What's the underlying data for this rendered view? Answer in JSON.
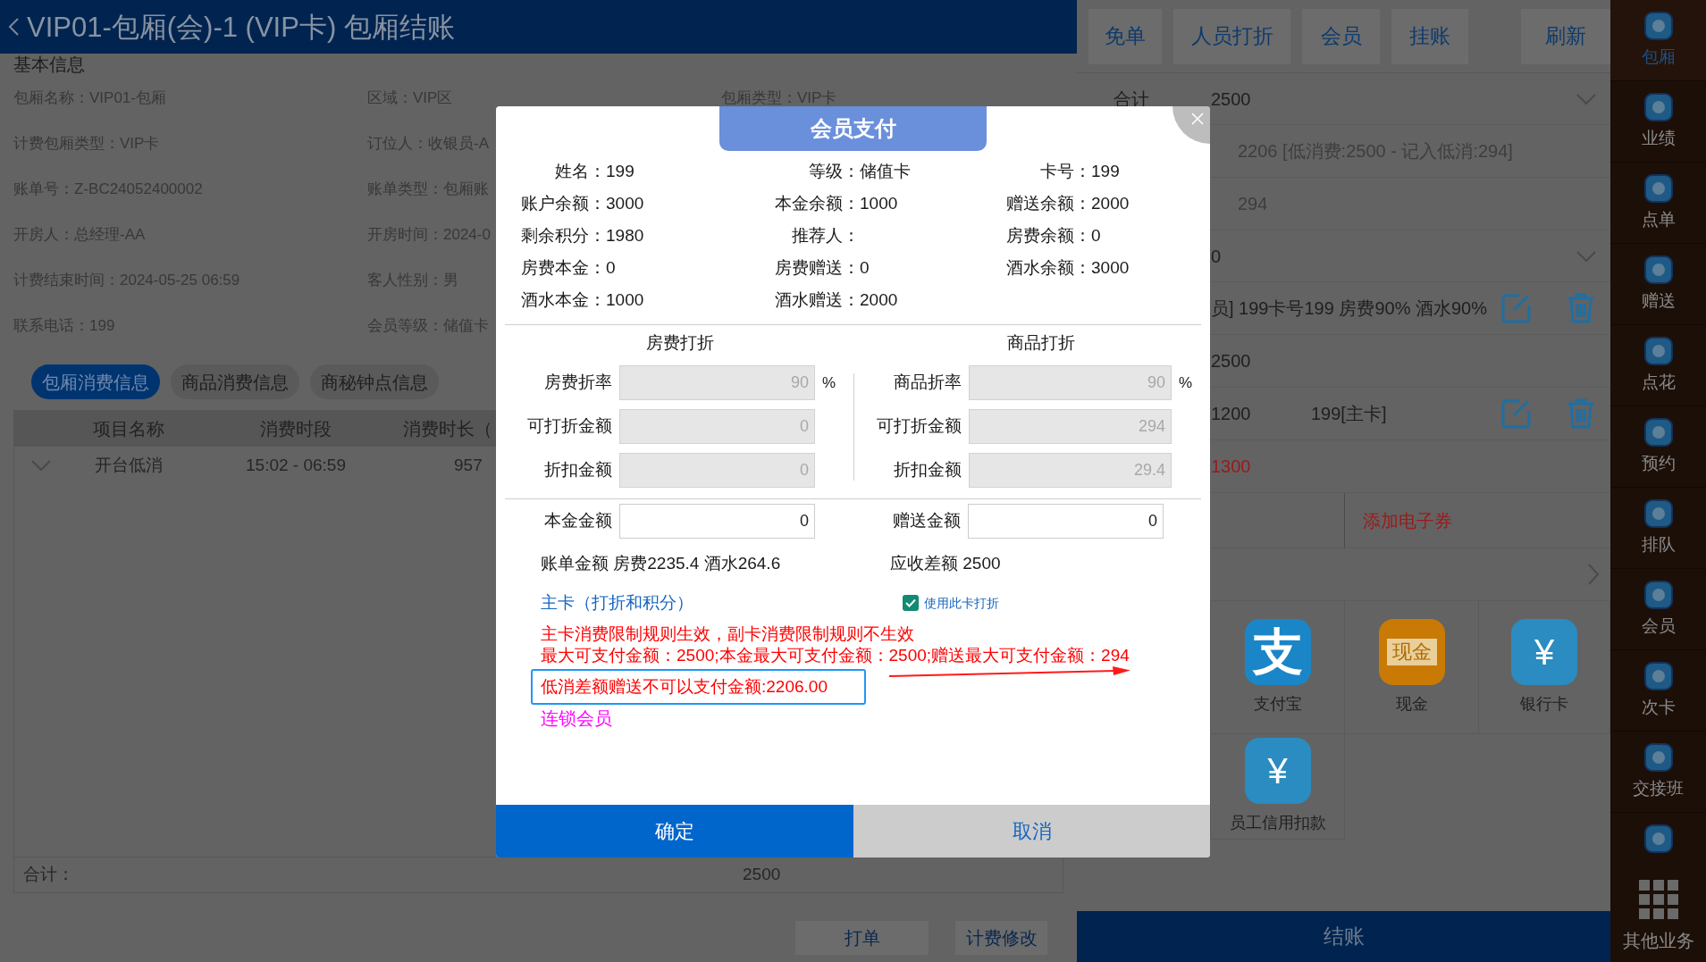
{
  "header": {
    "title": "VIP01-包厢(会)-1 (VIP卡) 包厢结账"
  },
  "basic_info": {
    "title": "基本信息",
    "rows": [
      [
        "包厢名称：VIP01-包厢",
        "区域：VIP区",
        "包厢类型：VIP卡"
      ],
      [
        "计费包厢类型：VIP卡",
        "订位人：收银员-A"
      ],
      [
        "账单号：Z-BC24052400002",
        "账单类型：包厢账"
      ],
      [
        "开房人：总经理-AA",
        "开房时间：2024-0"
      ],
      [
        "计费结束时间：2024-05-25 06:59",
        "客人性别：男"
      ],
      [
        "联系电话：199",
        "会员等级：储值卡"
      ]
    ]
  },
  "tabs": [
    {
      "label": "包厢消费信息",
      "selected": true
    },
    {
      "label": "商品消费信息",
      "selected": false
    },
    {
      "label": "商秘钟点信息",
      "selected": false
    }
  ],
  "table": {
    "columns": [
      "项目名称",
      "消费时段",
      "消费时长（"
    ],
    "rows": [
      {
        "expanded": false,
        "cells": [
          "开台低消",
          "15:02 - 06:59",
          "957"
        ]
      }
    ],
    "total_label": "合计：",
    "total_value": "2500"
  },
  "bottom_buttons": [
    "打单",
    "计费修改"
  ],
  "right_panel": {
    "actions": [
      "免单",
      "人员打折",
      "会员",
      "挂账",
      "刷新"
    ],
    "rows": [
      {
        "kind": "total",
        "label": "合计",
        "value": "2500",
        "expanded": false
      },
      {
        "kind": "detail",
        "value": "2206 [低消费:2500 - 记入低消:294]"
      },
      {
        "kind": "detail",
        "value": "294"
      },
      {
        "kind": "total",
        "value": "0",
        "expanded": false
      },
      {
        "kind": "entry",
        "value": "员] 199卡号199 房费90% 酒水90%"
      },
      {
        "kind": "plain",
        "value": "2500"
      },
      {
        "kind": "entry",
        "value": "1200",
        "note": "199[主卡]"
      },
      {
        "kind": "due",
        "value": "1300"
      },
      {
        "kind": "coupon",
        "value": "添加电子券"
      },
      {
        "kind": "more"
      }
    ],
    "payments": [
      {
        "kind": "alipay",
        "glyph": "支",
        "label": "支付宝"
      },
      {
        "kind": "cash",
        "glyph": "现金",
        "label": "现金"
      },
      {
        "kind": "card",
        "glyph": "¥",
        "label": "银行卡"
      },
      {
        "kind": "card",
        "glyph": "¥",
        "label": "员工信用扣款"
      }
    ],
    "checkout": "结账"
  },
  "sidebar": {
    "items": [
      {
        "label": "包厢",
        "selected": true
      },
      {
        "label": "业绩",
        "selected": false
      },
      {
        "label": "点单",
        "selected": false
      },
      {
        "label": "赠送",
        "selected": false
      },
      {
        "label": "点花",
        "selected": false
      },
      {
        "label": "预约",
        "selected": false
      },
      {
        "label": "排队",
        "selected": false
      },
      {
        "label": "会员",
        "selected": false
      },
      {
        "label": "次卡",
        "selected": false
      },
      {
        "label": "交接班",
        "selected": false
      },
      {
        "kind": "icon_only"
      }
    ],
    "more": "其他业务"
  },
  "dialog": {
    "title": "会员支付",
    "member": [
      [
        {
          "label": "姓名：",
          "value": "199"
        },
        {
          "label": "等级：",
          "value": "储值卡"
        },
        {
          "label": "卡号：",
          "value": "199"
        }
      ],
      [
        {
          "label": "账户余额：",
          "value": "3000"
        },
        {
          "label": "本金余额：",
          "value": "1000"
        },
        {
          "label": "赠送余额：",
          "value": "2000"
        }
      ],
      [
        {
          "label": "剩余积分：",
          "value": "1980"
        },
        {
          "label": "推荐人："
        },
        {
          "label": "房费余额：",
          "value": "0"
        }
      ],
      [
        {
          "label": "房费本金：",
          "value": "0"
        },
        {
          "label": "房费赠送：",
          "value": "0"
        },
        {
          "label": "酒水余额：",
          "value": "3000"
        }
      ],
      [
        {
          "label": "酒水本金：",
          "value": "1000"
        },
        {
          "label": "酒水赠送：",
          "value": "2000"
        }
      ]
    ],
    "discounts": [
      {
        "title": "房费打折",
        "fields": [
          {
            "label": "房费折率",
            "value": "90",
            "unit": "%",
            "disabled": true
          },
          {
            "label": "可打折金额",
            "value": "0",
            "disabled": true
          },
          {
            "label": "折扣金额",
            "value": "0",
            "disabled": true
          }
        ]
      },
      {
        "title": "商品打折",
        "fields": [
          {
            "label": "商品折率",
            "value": "90",
            "unit": "%",
            "disabled": true
          },
          {
            "label": "可打折金额",
            "value": "294",
            "disabled": true
          },
          {
            "label": "折扣金额",
            "value": "29.4",
            "disabled": true
          }
        ]
      }
    ],
    "amounts": [
      {
        "label": "本金金额",
        "value": "0",
        "disabled": false
      },
      {
        "label": "赠送金额",
        "value": "0",
        "disabled": false
      }
    ],
    "bill": "账单金额 房费2235.4 酒水264.6",
    "due": "应收差额 2500",
    "main_card": "主卡（打折和积分）",
    "use_card_discount": {
      "label": "使用此卡打折",
      "checked": true
    },
    "messages": [
      {
        "text": "主卡消费限制规则生效，副卡消费限制规则不生效",
        "highlighted": false
      },
      {
        "text": "最大可支付金额：2500;本金最大可支付金额：2500;赠送最大可支付金额：294",
        "highlighted": false
      },
      {
        "text": "低消差额赠送不可以支付金额:2206.00",
        "highlighted": true
      }
    ],
    "chain_member": "连锁会员",
    "confirm": "确定",
    "cancel": "取消"
  }
}
